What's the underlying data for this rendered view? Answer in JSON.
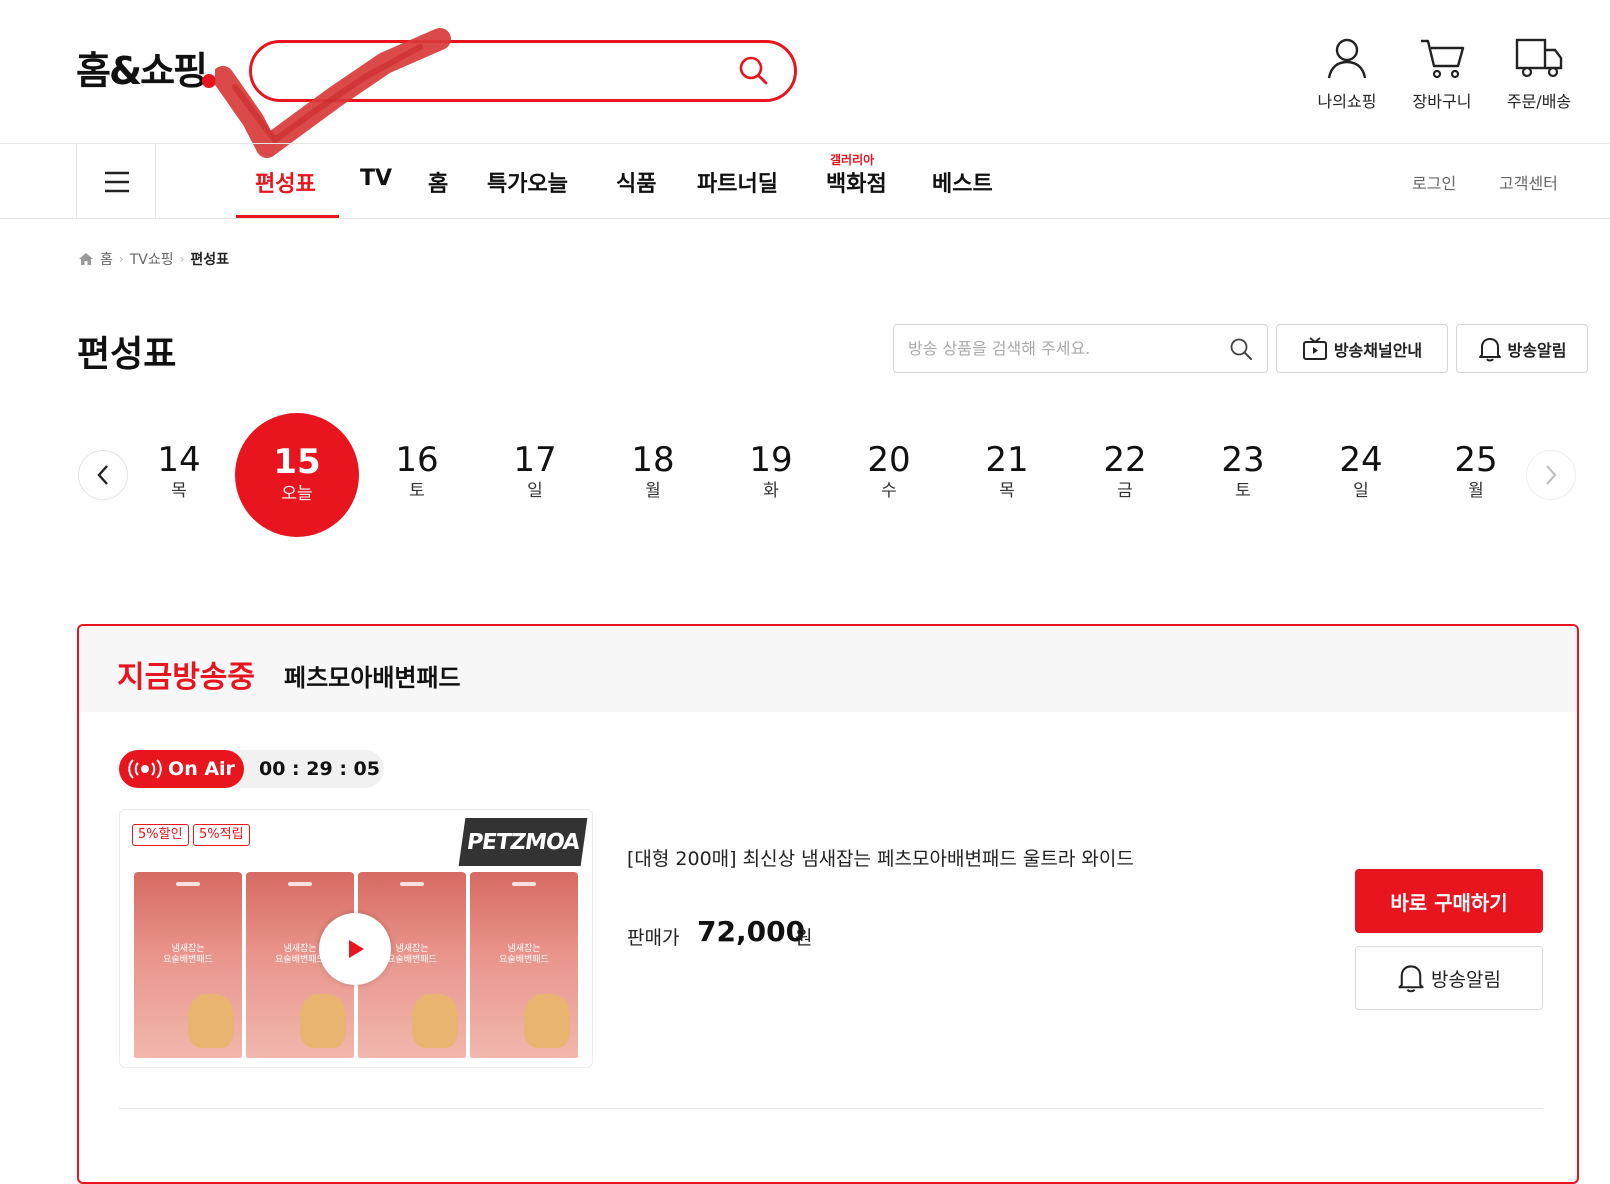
{
  "header": {
    "logo": "홈&쇼핑",
    "search": {
      "value": "",
      "placeholder": ""
    },
    "utils": [
      {
        "label": "나의쇼핑",
        "icon": "user-icon"
      },
      {
        "label": "장바구니",
        "icon": "cart-icon"
      },
      {
        "label": "주문/배송",
        "icon": "truck-icon"
      }
    ]
  },
  "nav": {
    "items": [
      {
        "label": "편성표",
        "active": true
      },
      {
        "label": "TV"
      },
      {
        "label": "홈"
      },
      {
        "label": "특가오늘"
      },
      {
        "label": "식품"
      },
      {
        "label": "파트너딜"
      },
      {
        "label": "백화점",
        "tag": "갤러리아"
      },
      {
        "label": "베스트"
      }
    ],
    "login": "로그인",
    "customer_center": "고객센터"
  },
  "breadcrumb": [
    "홈",
    "TV쇼핑",
    "편성표"
  ],
  "page": {
    "title": "편성표",
    "product_search_placeholder": "방송 상품을 검색해 주세요.",
    "channel_guide": "방송채널안내",
    "broadcast_alert": "방송알림"
  },
  "dates": [
    {
      "num": "14",
      "day": "목"
    },
    {
      "num": "15",
      "day": "오늘",
      "selected": true
    },
    {
      "num": "16",
      "day": "토"
    },
    {
      "num": "17",
      "day": "일"
    },
    {
      "num": "18",
      "day": "월"
    },
    {
      "num": "19",
      "day": "화"
    },
    {
      "num": "20",
      "day": "수"
    },
    {
      "num": "21",
      "day": "목"
    },
    {
      "num": "22",
      "day": "금"
    },
    {
      "num": "23",
      "day": "토"
    },
    {
      "num": "24",
      "day": "일"
    },
    {
      "num": "25",
      "day": "월"
    }
  ],
  "live": {
    "label": "지금방송중",
    "title": "페츠모아배변패드",
    "on_air": "On Air",
    "timer": "00 : 29 : 05",
    "tags": [
      "5%할인",
      "5%적립"
    ],
    "brand": "PETZMOA",
    "pack_label": "냄새잡는\n요술배변패드",
    "product_name": "[대형 200매] 최신상 냄새잡는 페츠모아배변패드 울트라 와이드",
    "price_label": "판매가",
    "price": "72,000",
    "price_unit": "원",
    "buy_button": "바로 구매하기",
    "alert_button": "방송알림"
  },
  "colors": {
    "accent": "#e8141e"
  }
}
